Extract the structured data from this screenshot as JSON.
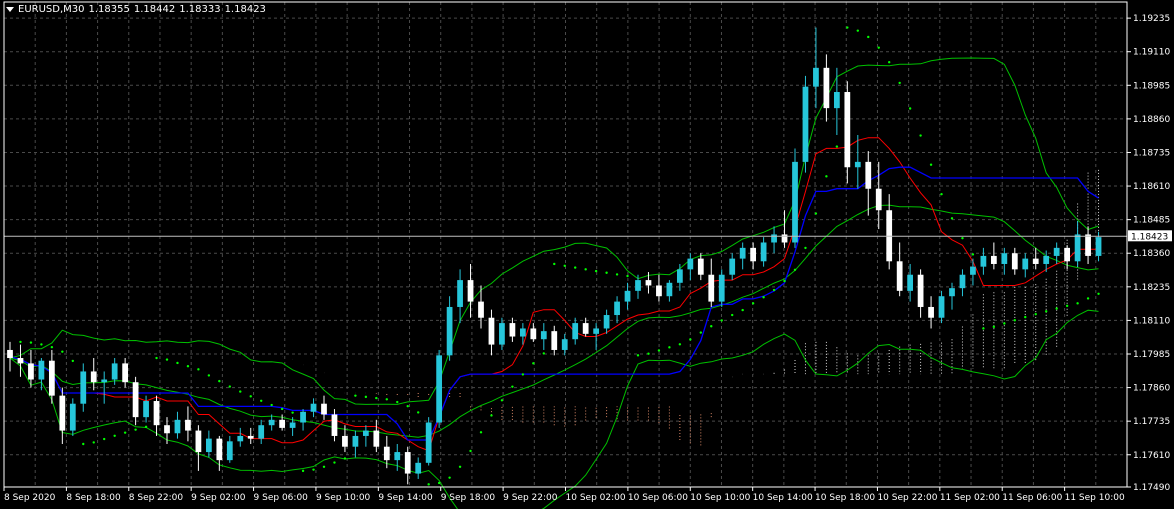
{
  "header": {
    "symbol": "EURUSD,M30",
    "open": "1.18355",
    "high": "1.18442",
    "low": "1.18333",
    "close": "1.18423"
  },
  "current_price_label": "1.18423",
  "colors": {
    "background": "#000000",
    "grid": "#4a4a4a",
    "bull_candle": "#26c6da",
    "bear_candle": "#ffffff",
    "tenkan": "#ff0000",
    "kijun": "#0000ff",
    "bollinger": "#00c000",
    "parabolic_sar": "#00ff00",
    "cloud_a": "#ffffff",
    "cloud_b": "#ffa07a",
    "oscillator": "#00c000"
  },
  "chart_data": {
    "type": "candlestick",
    "symbol": "EURUSD",
    "timeframe": "M30",
    "y_ticks": [
      "1.19235",
      "1.19110",
      "1.18985",
      "1.18860",
      "1.18735",
      "1.18610",
      "1.18485",
      "1.18360",
      "1.18235",
      "1.18110",
      "1.17985",
      "1.17860",
      "1.17735",
      "1.17610",
      "1.17490"
    ],
    "ylim": [
      1.1749,
      1.19295
    ],
    "x_ticks": [
      "8 Sep 2020",
      "8 Sep 18:00",
      "8 Sep 22:00",
      "9 Sep 02:00",
      "9 Sep 06:00",
      "9 Sep 10:00",
      "9 Sep 14:00",
      "9 Sep 18:00",
      "9 Sep 22:00",
      "10 Sep 02:00",
      "10 Sep 06:00",
      "10 Sep 10:00",
      "10 Sep 14:00",
      "10 Sep 18:00",
      "10 Sep 22:00",
      "11 Sep 02:00",
      "11 Sep 06:00",
      "11 Sep 10:00"
    ],
    "current_price": 1.18423,
    "candles": [
      [
        1.18,
        1.1803,
        1.1792,
        1.1797
      ],
      [
        1.1797,
        1.1802,
        1.179,
        1.1795
      ],
      [
        1.1795,
        1.18,
        1.1786,
        1.1789
      ],
      [
        1.1789,
        1.1797,
        1.1785,
        1.1796
      ],
      [
        1.1796,
        1.18,
        1.178,
        1.1783
      ],
      [
        1.1783,
        1.1786,
        1.1765,
        1.177
      ],
      [
        1.177,
        1.1782,
        1.1768,
        1.178
      ],
      [
        1.178,
        1.1795,
        1.1777,
        1.1792
      ],
      [
        1.1792,
        1.1797,
        1.1785,
        1.1788
      ],
      [
        1.1788,
        1.1792,
        1.178,
        1.1789
      ],
      [
        1.1789,
        1.1797,
        1.1787,
        1.1795
      ],
      [
        1.1795,
        1.1797,
        1.1786,
        1.1788
      ],
      [
        1.1788,
        1.179,
        1.1772,
        1.1775
      ],
      [
        1.1775,
        1.1783,
        1.1773,
        1.1781
      ],
      [
        1.1781,
        1.1783,
        1.1768,
        1.1772
      ],
      [
        1.1772,
        1.1775,
        1.1765,
        1.1769
      ],
      [
        1.1769,
        1.1777,
        1.1767,
        1.1774
      ],
      [
        1.1774,
        1.1779,
        1.1766,
        1.177
      ],
      [
        1.177,
        1.1772,
        1.1755,
        1.1762
      ],
      [
        1.1762,
        1.177,
        1.176,
        1.1767
      ],
      [
        1.1767,
        1.1768,
        1.1755,
        1.1759
      ],
      [
        1.1759,
        1.1768,
        1.1758,
        1.1766
      ],
      [
        1.1766,
        1.1771,
        1.1764,
        1.1768
      ],
      [
        1.1768,
        1.1771,
        1.1765,
        1.1767
      ],
      [
        1.1767,
        1.1774,
        1.1765,
        1.1772
      ],
      [
        1.1772,
        1.1776,
        1.177,
        1.1774
      ],
      [
        1.1774,
        1.1776,
        1.177,
        1.1771
      ],
      [
        1.1771,
        1.1775,
        1.1768,
        1.1773
      ],
      [
        1.1773,
        1.1778,
        1.177,
        1.1777
      ],
      [
        1.1777,
        1.1782,
        1.1775,
        1.178
      ],
      [
        1.178,
        1.1783,
        1.1774,
        1.1776
      ],
      [
        1.1776,
        1.1778,
        1.1766,
        1.1768
      ],
      [
        1.1768,
        1.1772,
        1.1762,
        1.1764
      ],
      [
        1.1764,
        1.177,
        1.176,
        1.1768
      ],
      [
        1.1768,
        1.1772,
        1.1764,
        1.177
      ],
      [
        1.177,
        1.1774,
        1.1762,
        1.1764
      ],
      [
        1.1764,
        1.1768,
        1.1756,
        1.1759
      ],
      [
        1.1759,
        1.1765,
        1.1755,
        1.1762
      ],
      [
        1.1762,
        1.1764,
        1.175,
        1.1754
      ],
      [
        1.1754,
        1.176,
        1.1752,
        1.1758
      ],
      [
        1.1758,
        1.1775,
        1.1757,
        1.1773
      ],
      [
        1.1773,
        1.18,
        1.1771,
        1.1798
      ],
      [
        1.1798,
        1.182,
        1.1796,
        1.1816
      ],
      [
        1.1816,
        1.183,
        1.181,
        1.1826
      ],
      [
        1.1826,
        1.1832,
        1.1812,
        1.1818
      ],
      [
        1.1818,
        1.1824,
        1.1808,
        1.1812
      ],
      [
        1.1812,
        1.1815,
        1.1798,
        1.1802
      ],
      [
        1.1802,
        1.1812,
        1.18,
        1.181
      ],
      [
        1.181,
        1.1812,
        1.1803,
        1.1805
      ],
      [
        1.1805,
        1.181,
        1.1802,
        1.1808
      ],
      [
        1.1808,
        1.181,
        1.1803,
        1.1804
      ],
      [
        1.1804,
        1.181,
        1.18,
        1.1807
      ],
      [
        1.1807,
        1.1809,
        1.1798,
        1.18
      ],
      [
        1.18,
        1.1806,
        1.1798,
        1.1804
      ],
      [
        1.1804,
        1.1812,
        1.1802,
        1.181
      ],
      [
        1.181,
        1.1812,
        1.1805,
        1.1806
      ],
      [
        1.1806,
        1.181,
        1.18,
        1.1808
      ],
      [
        1.1808,
        1.1815,
        1.1806,
        1.1813
      ],
      [
        1.1813,
        1.182,
        1.181,
        1.1818
      ],
      [
        1.1818,
        1.1825,
        1.1815,
        1.1822
      ],
      [
        1.1822,
        1.1828,
        1.1819,
        1.1826
      ],
      [
        1.1826,
        1.1829,
        1.1821,
        1.1824
      ],
      [
        1.1824,
        1.1828,
        1.1818,
        1.182
      ],
      [
        1.182,
        1.1826,
        1.1818,
        1.1825
      ],
      [
        1.1825,
        1.1832,
        1.1822,
        1.183
      ],
      [
        1.183,
        1.1836,
        1.1826,
        1.1834
      ],
      [
        1.1834,
        1.1836,
        1.1826,
        1.1828
      ],
      [
        1.1828,
        1.1834,
        1.1816,
        1.1818
      ],
      [
        1.1818,
        1.183,
        1.1816,
        1.1828
      ],
      [
        1.1828,
        1.1836,
        1.1826,
        1.1834
      ],
      [
        1.1834,
        1.184,
        1.183,
        1.1838
      ],
      [
        1.1838,
        1.184,
        1.183,
        1.1833
      ],
      [
        1.1833,
        1.1842,
        1.1831,
        1.184
      ],
      [
        1.184,
        1.1846,
        1.1836,
        1.1843
      ],
      [
        1.1843,
        1.1852,
        1.1838,
        1.184
      ],
      [
        1.184,
        1.1875,
        1.1838,
        1.187
      ],
      [
        1.187,
        1.1902,
        1.1866,
        1.1898
      ],
      [
        1.1898,
        1.192,
        1.189,
        1.1905
      ],
      [
        1.1905,
        1.191,
        1.1885,
        1.189
      ],
      [
        1.189,
        1.1905,
        1.188,
        1.1896
      ],
      [
        1.1896,
        1.19,
        1.1862,
        1.1868
      ],
      [
        1.1868,
        1.188,
        1.186,
        1.187
      ],
      [
        1.187,
        1.1874,
        1.185,
        1.186
      ],
      [
        1.186,
        1.187,
        1.1845,
        1.1852
      ],
      [
        1.1852,
        1.1858,
        1.183,
        1.1833
      ],
      [
        1.1833,
        1.184,
        1.182,
        1.1822
      ],
      [
        1.1822,
        1.1832,
        1.1818,
        1.1828
      ],
      [
        1.1828,
        1.183,
        1.1812,
        1.1816
      ],
      [
        1.1816,
        1.182,
        1.1808,
        1.1812
      ],
      [
        1.1812,
        1.1822,
        1.181,
        1.182
      ],
      [
        1.182,
        1.1825,
        1.1815,
        1.1823
      ],
      [
        1.1823,
        1.183,
        1.182,
        1.1828
      ],
      [
        1.1828,
        1.1834,
        1.1824,
        1.1831
      ],
      [
        1.1831,
        1.1838,
        1.1828,
        1.1835
      ],
      [
        1.1835,
        1.184,
        1.183,
        1.1832
      ],
      [
        1.1832,
        1.1838,
        1.1828,
        1.1836
      ],
      [
        1.1836,
        1.1838,
        1.1828,
        1.183
      ],
      [
        1.183,
        1.1836,
        1.1827,
        1.1834
      ],
      [
        1.1834,
        1.1838,
        1.183,
        1.1832
      ],
      [
        1.1832,
        1.1837,
        1.1829,
        1.1835
      ],
      [
        1.1835,
        1.184,
        1.1832,
        1.1838
      ],
      [
        1.1838,
        1.1839,
        1.183,
        1.1833
      ],
      [
        1.1833,
        1.1848,
        1.1831,
        1.1843
      ],
      [
        1.1843,
        1.1846,
        1.1832,
        1.1835
      ],
      [
        1.1835,
        1.1844,
        1.1833,
        1.1842
      ]
    ]
  }
}
